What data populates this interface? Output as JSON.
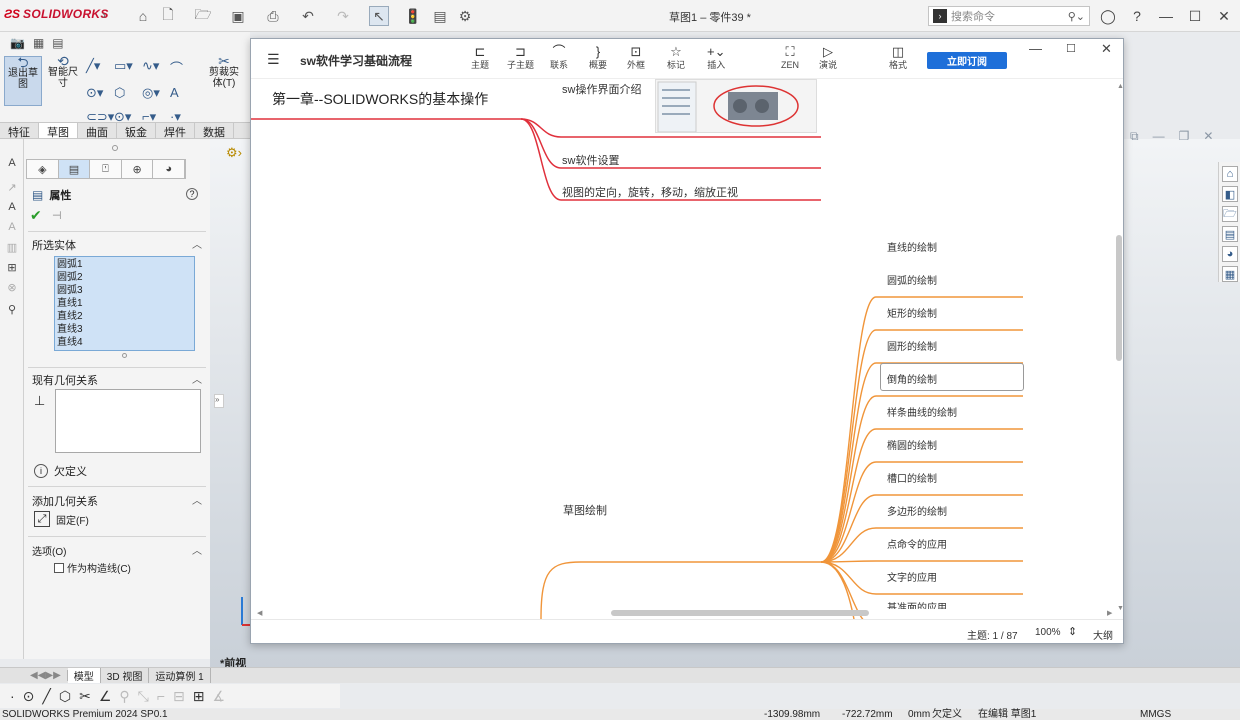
{
  "app": {
    "brand": "SOLIDWORKS",
    "window_title": "草图1 – 零件39 *"
  },
  "search": {
    "placeholder": "搜索命令"
  },
  "command_manager": {
    "exit_sketch": "退出草图",
    "smart_dim": "智能尺寸",
    "trim": "剪裁实体(T)"
  },
  "tabs": [
    "特征",
    "草图",
    "曲面",
    "钣金",
    "焊件",
    "数据"
  ],
  "active_tab_index": 1,
  "pm": {
    "title": "属性",
    "selected_section": "所选实体",
    "selected_items": [
      "圆弧1",
      "圆弧2",
      "圆弧3",
      "直线1",
      "直线2",
      "直线3",
      "直线4"
    ],
    "existing_section": "现有几何关系",
    "under_defined": "欠定义",
    "add_section": "添加几何关系",
    "fix_label": "固定(F)",
    "options_section": "选项(O)",
    "construction_label": "作为构造线(C)"
  },
  "graphics": {
    "view_label": "*前视"
  },
  "bottom_tabs": [
    "模型",
    "3D 视图",
    "运动算例 1"
  ],
  "status_bar": {
    "product": "SOLIDWORKS Premium 2024 SP0.1",
    "x": "-1309.98mm",
    "y": "-722.72mm",
    "z": "0mm",
    "defined": "欠定义",
    "editing": "在编辑 草图1",
    "units": "MMGS"
  },
  "mindmap": {
    "title": "sw软件学习基础流程",
    "toolbar": [
      {
        "icon": "topic-icon",
        "glyph": "⊏",
        "label": "主题"
      },
      {
        "icon": "subtopic-icon",
        "glyph": "⊐",
        "label": "子主题"
      },
      {
        "icon": "relation-icon",
        "glyph": "⌒",
        "label": "联系"
      },
      {
        "icon": "summary-icon",
        "glyph": "}",
        "label": "概要"
      },
      {
        "icon": "boundary-icon",
        "glyph": "⊡",
        "label": "外框"
      },
      {
        "icon": "marker-icon",
        "glyph": "☆",
        "label": "标记"
      },
      {
        "icon": "insert-icon",
        "glyph": "+⌄",
        "label": "插入"
      }
    ],
    "zen_label": "ZEN",
    "present_label": "演说",
    "format_label": "格式",
    "subscribe_label": "立即订阅",
    "root_topic": "第一章--SOLIDWORKS的基本操作",
    "red_branches": [
      "sw操作界面介绍",
      "sw软件设置",
      "视图的定向，旋转，移动，缩放正视"
    ],
    "orange_parent": "草图绘制",
    "orange_children": [
      "直线的绘制",
      "圆弧的绘制",
      "矩形的绘制",
      "圆形的绘制",
      "倒角的绘制",
      "样条曲线的绘制",
      "椭圆的绘制",
      "槽口的绘制",
      "多边形的绘制",
      "点命令的应用",
      "文字的应用",
      "基准面的应用"
    ],
    "selected_child_index": 4,
    "footer": {
      "topic_count": "主题: 1 / 87",
      "zoom": "100%",
      "outline": "大纲"
    },
    "colors": {
      "red": "#e0303c",
      "orange": "#f0953a",
      "accent": "#1e6fd9"
    }
  }
}
